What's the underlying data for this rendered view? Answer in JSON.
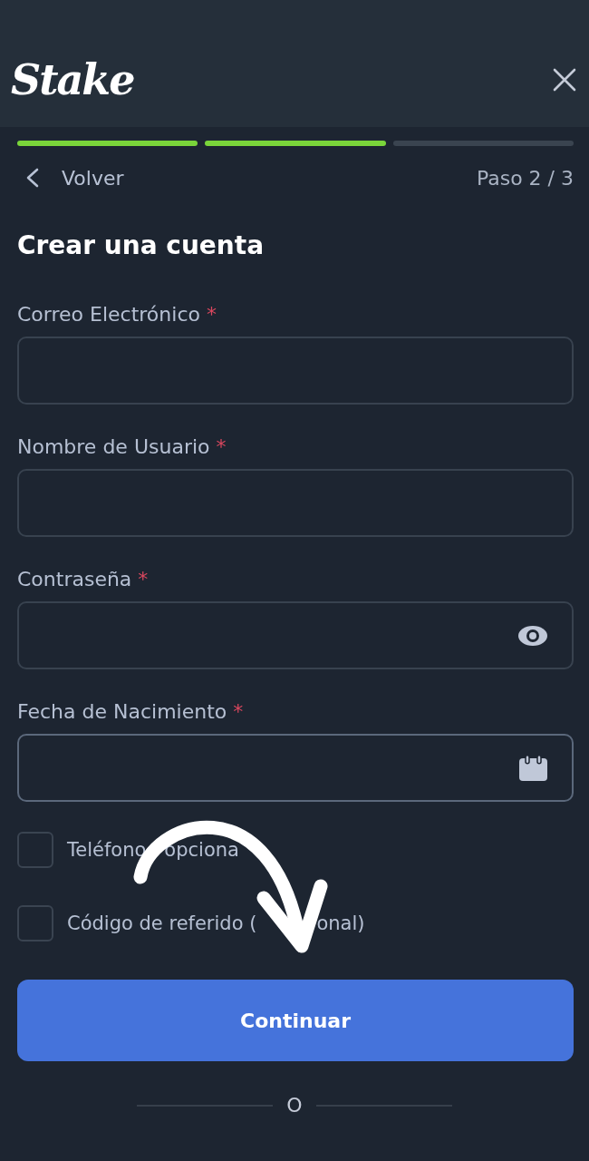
{
  "header": {
    "logo": "Stake"
  },
  "progress": {
    "steps": [
      {
        "complete": true
      },
      {
        "complete": true
      },
      {
        "complete": false
      }
    ]
  },
  "nav": {
    "back_label": "Volver",
    "step": "Paso 2 / 3"
  },
  "title": "Crear una cuenta",
  "fields": [
    {
      "label": "Correo Electrónico",
      "required_mark": "*",
      "kind": "text",
      "focused": false
    },
    {
      "label": "Nombre de Usuario",
      "required_mark": "*",
      "kind": "text",
      "focused": false
    },
    {
      "label": "Contraseña",
      "required_mark": "*",
      "kind": "password",
      "focused": false
    },
    {
      "label": "Fecha de Nacimiento",
      "required_mark": "*",
      "kind": "date",
      "focused": true
    }
  ],
  "options": [
    {
      "label_parts": [
        "Teléfono",
        "opciona"
      ],
      "checked": false
    },
    {
      "label_parts": [
        "Código de referido (",
        "onal)"
      ],
      "checked": false
    }
  ],
  "submit": {
    "label": "Continuar"
  },
  "divider": {
    "text": "O"
  }
}
